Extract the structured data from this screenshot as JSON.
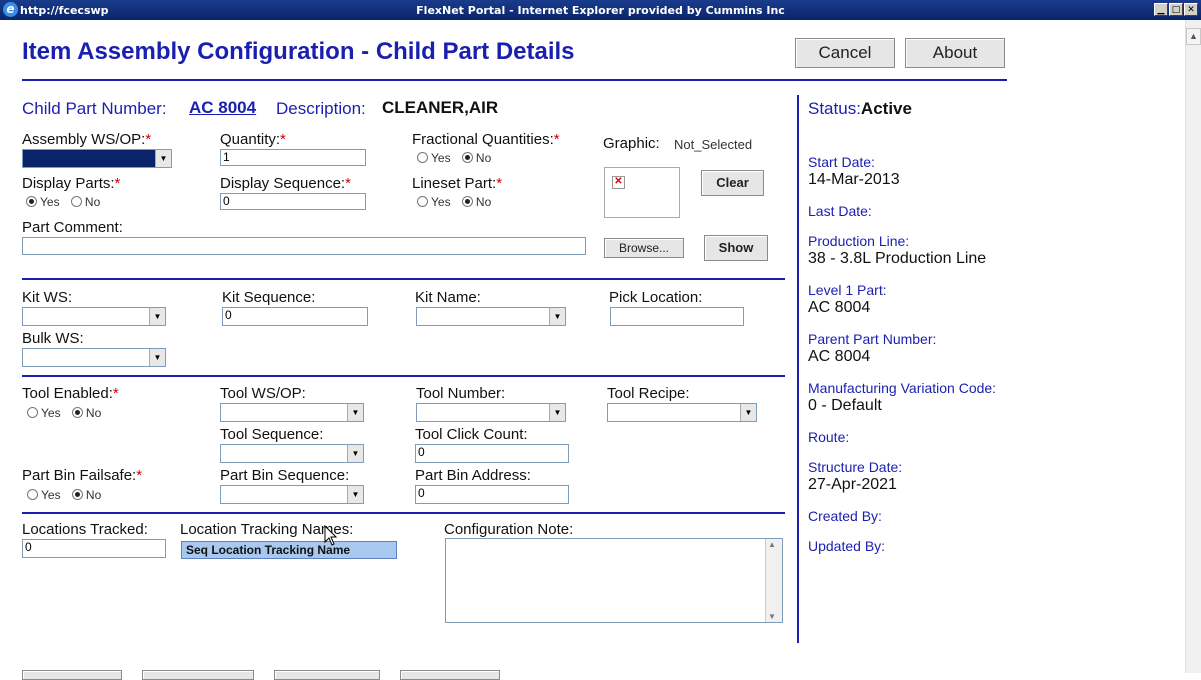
{
  "window": {
    "url": "http://fcecswp",
    "title": "FlexNet Portal - Internet Explorer provided by Cummins Inc"
  },
  "header": {
    "title": "Item Assembly Configuration - Child Part Details",
    "cancel_label": "Cancel",
    "about_label": "About"
  },
  "part": {
    "number_label": "Child Part Number:",
    "number": "AC 8004",
    "description_label": "Description:",
    "description": "CLEANER,AIR"
  },
  "status": {
    "label": "Status:",
    "value": "Active"
  },
  "form": {
    "assembly_ws_op_label": "Assembly WS/OP:",
    "quantity_label": "Quantity:",
    "quantity_value": "1",
    "fractional_label": "Fractional Quantities:",
    "graphic_label": "Graphic:",
    "graphic_value": "Not_Selected",
    "clear_label": "Clear",
    "display_parts_label": "Display Parts:",
    "display_sequence_label": "Display Sequence:",
    "display_sequence_value": "0",
    "lineset_part_label": "Lineset Part:",
    "part_comment_label": "Part Comment:",
    "browse_label": "Browse...",
    "show_label": "Show",
    "yes": "Yes",
    "no": "No",
    "required_mark": "*"
  },
  "kit": {
    "kit_ws_label": "Kit WS:",
    "kit_sequence_label": "Kit Sequence:",
    "kit_sequence_value": "0",
    "kit_name_label": "Kit Name:",
    "pick_location_label": "Pick Location:",
    "bulk_ws_label": "Bulk WS:"
  },
  "tool": {
    "tool_enabled_label": "Tool Enabled:",
    "tool_ws_op_label": "Tool WS/OP:",
    "tool_number_label": "Tool Number:",
    "tool_recipe_label": "Tool Recipe:",
    "tool_sequence_label": "Tool Sequence:",
    "tool_click_count_label": "Tool Click Count:",
    "tool_click_count_value": "0",
    "part_bin_failsafe_label": "Part Bin Failsafe:",
    "part_bin_sequence_label": "Part Bin Sequence:",
    "part_bin_address_label": "Part Bin Address:",
    "part_bin_address_value": "0"
  },
  "tracking": {
    "locations_tracked_label": "Locations Tracked:",
    "locations_tracked_value": "0",
    "location_tracking_names_label": "Location Tracking Names:",
    "list_header": "Seq  Location Tracking Name",
    "configuration_note_label": "Configuration Note:"
  },
  "sidebar": {
    "start_date_label": "Start Date:",
    "start_date": "14-Mar-2013",
    "last_date_label": "Last Date:",
    "production_line_label": "Production Line:",
    "production_line": "38 - 3.8L Production Line",
    "level1_part_label": "Level 1 Part:",
    "level1_part": "AC 8004",
    "parent_part_label": "Parent Part Number:",
    "parent_part": "AC 8004",
    "mfg_variation_label": "Manufacturing Variation Code:",
    "mfg_variation": "0 - Default",
    "route_label": "Route:",
    "structure_date_label": "Structure Date:",
    "structure_date": "27-Apr-2021",
    "created_by_label": "Created By:",
    "updated_by_label": "Updated By:"
  },
  "colors": {
    "accent": "#1a1fb0",
    "required": "#d00000"
  }
}
